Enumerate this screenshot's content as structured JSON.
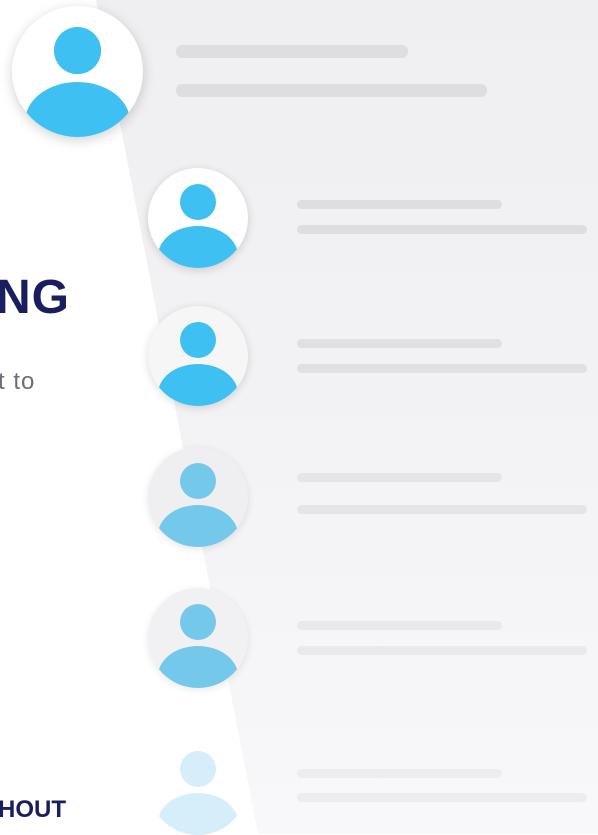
{
  "text": {
    "heading": "NG",
    "body": "t to",
    "footer": "HOUT"
  },
  "colors": {
    "avatar_blue": "#3fc0f2",
    "avatar_faded": "#74c9ea",
    "avatar_ghost": "#d6eefa",
    "heading_navy": "#1b1e5e",
    "placeholder_gray": "#dedee0"
  },
  "contacts": [
    {
      "name": "user-avatar-1",
      "icon": "user-icon",
      "state": "loaded"
    },
    {
      "name": "user-avatar-2",
      "icon": "user-icon",
      "state": "loaded"
    },
    {
      "name": "user-avatar-3",
      "icon": "user-icon",
      "state": "loaded"
    },
    {
      "name": "user-avatar-4",
      "icon": "user-icon",
      "state": "faded"
    },
    {
      "name": "user-avatar-5",
      "icon": "user-icon",
      "state": "faded"
    },
    {
      "name": "user-avatar-6",
      "icon": "user-icon",
      "state": "ghost"
    }
  ]
}
